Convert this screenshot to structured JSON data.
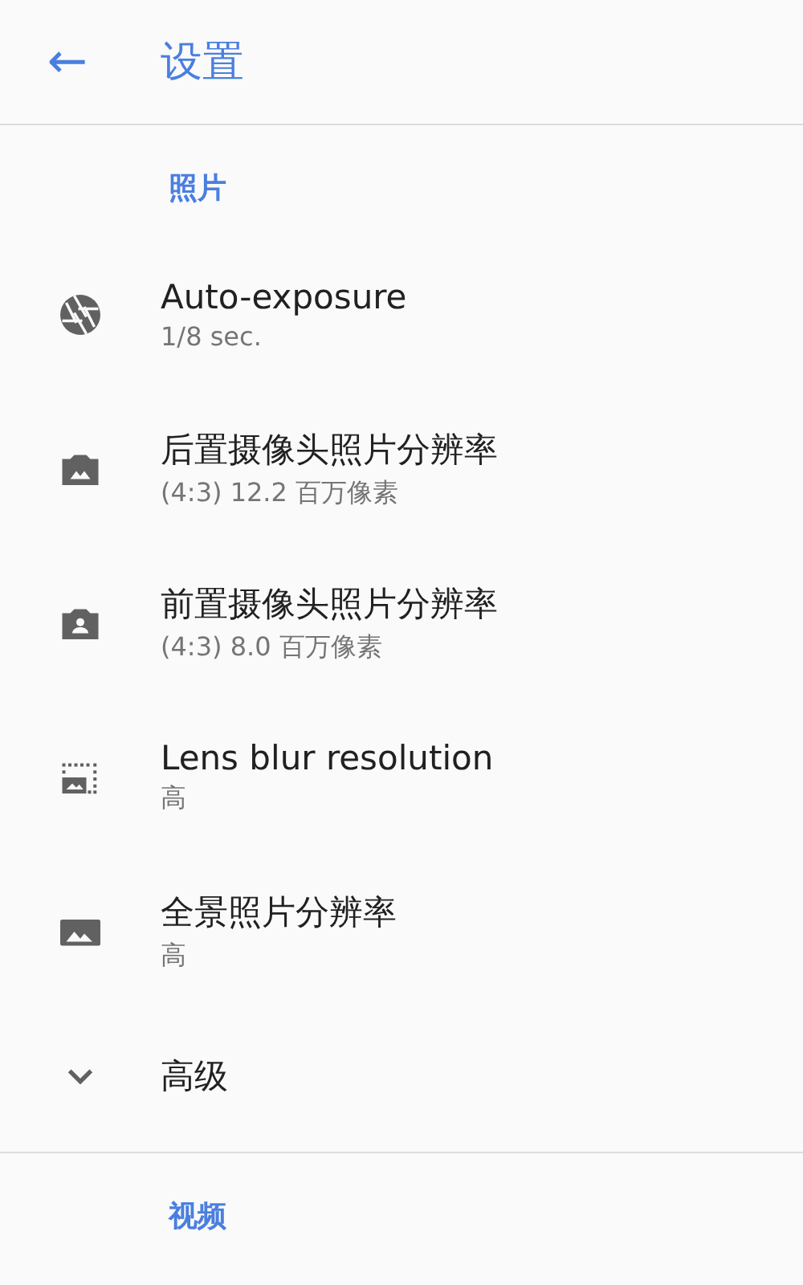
{
  "app_bar": {
    "back_icon": "←",
    "title": "设置"
  },
  "sections": [
    {
      "title": "照片",
      "items": [
        {
          "kind": "aperture",
          "title": "Auto-exposure",
          "summary": "1/8 sec."
        },
        {
          "kind": "camera-landscape",
          "title": "后置摄像头照片分辨率",
          "summary": "(4:3) 12.2 百万像素"
        },
        {
          "kind": "camera-person",
          "title": "前置摄像头照片分辨率",
          "summary": "(4:3) 8.0 百万像素"
        },
        {
          "kind": "blur-frame",
          "title": "Lens blur resolution",
          "summary": "高"
        },
        {
          "kind": "landscape",
          "title": "全景照片分辨率",
          "summary": "高"
        },
        {
          "kind": "expander",
          "title": "高级"
        }
      ]
    },
    {
      "title": "视频"
    }
  ]
}
